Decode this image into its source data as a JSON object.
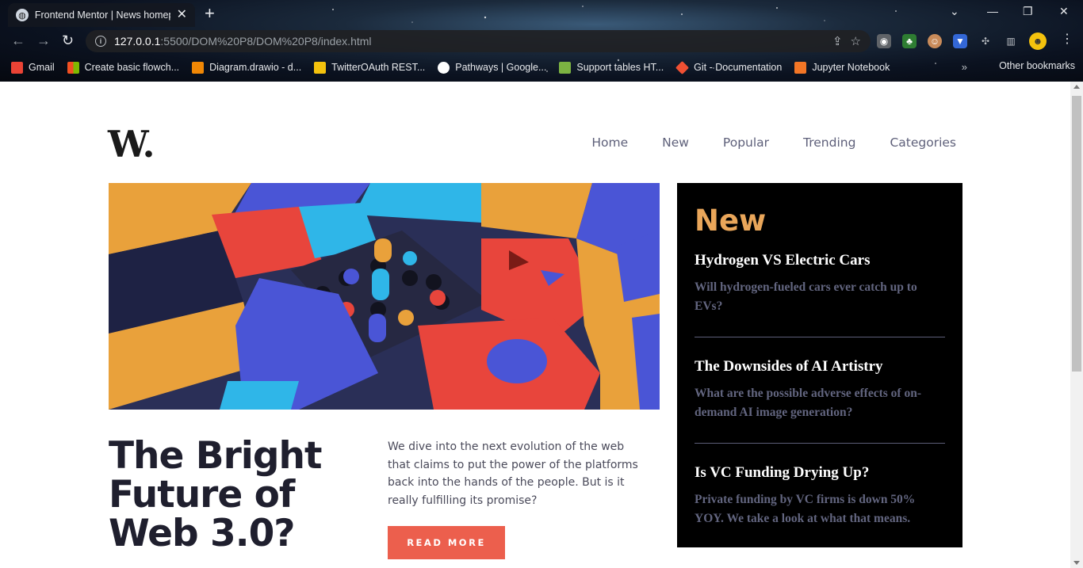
{
  "browser": {
    "tab_title": "Frontend Mentor | News homepage",
    "url_host": "127.0.0.1",
    "url_path": ":5500/DOM%20P8/DOM%20P8/index.html",
    "bookmarks": [
      {
        "label": "Gmail",
        "color": "#ea4335"
      },
      {
        "label": "Create basic flowch...",
        "color": "#f25022"
      },
      {
        "label": "Diagram.drawio - d...",
        "color": "#f08705"
      },
      {
        "label": "TwitterOAuth REST...",
        "color": "#f4c20d"
      },
      {
        "label": "Pathways  |  Google...",
        "color": "#ffffff"
      },
      {
        "label": "Support tables HT...",
        "color": "#7cb342"
      },
      {
        "label": "Git - Documentation",
        "color": "#f05033"
      },
      {
        "label": "Jupyter Notebook",
        "color": "#f37626"
      }
    ],
    "other_bookmarks": "Other bookmarks"
  },
  "site": {
    "logo": "W.",
    "nav": [
      "Home",
      "New",
      "Popular",
      "Trending",
      "Categories"
    ]
  },
  "main": {
    "headline": "The Bright Future of Web 3.0?",
    "lead": "We dive into the next evolution of the web that claims to put the power of the platforms back into the hands of the people. But is it really fulfilling its promise?",
    "cta": "READ MORE"
  },
  "new_panel": {
    "title": "New",
    "items": [
      {
        "title": "Hydrogen VS Electric Cars",
        "desc": "Will hydrogen-fueled cars ever catch up to EVs?"
      },
      {
        "title": "The Downsides of AI Artistry",
        "desc": "What are the possible adverse effects of on-demand AI image generation?"
      },
      {
        "title": "Is VC Funding Drying Up?",
        "desc": "Private funding by VC firms is down 50% YOY. We take a look at what that means."
      }
    ]
  },
  "colors": {
    "accent_red": "#ec5f4d",
    "accent_orange": "#e9a65a",
    "dark": "#000000",
    "muted": "#5d5f79"
  }
}
